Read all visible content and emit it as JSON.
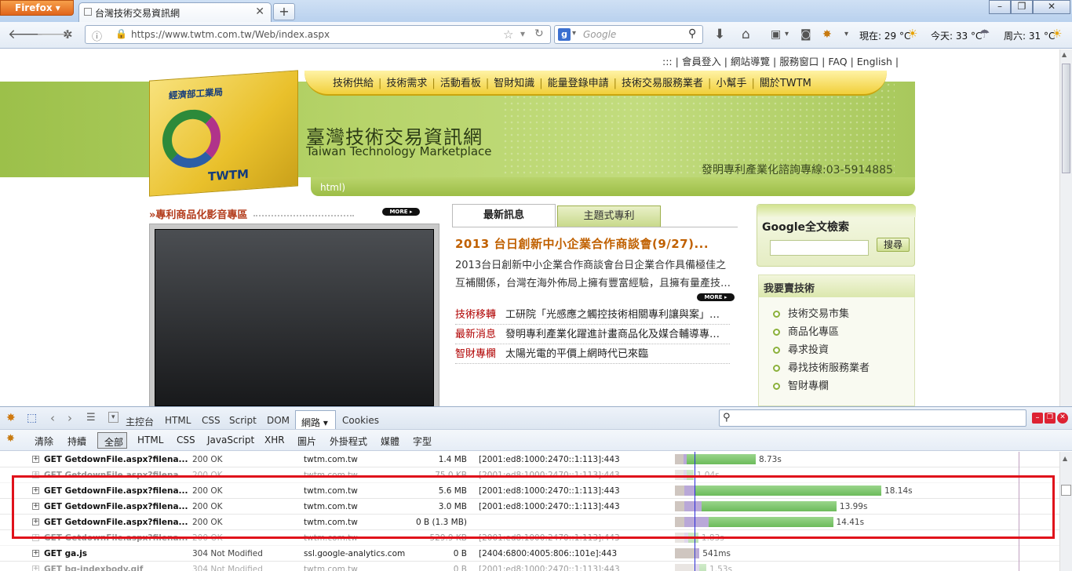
{
  "browser": {
    "app_button": "Firefox",
    "tab_title": "台灣技術交易資訊網",
    "new_tab": "+",
    "url": "https://www.twtm.com.tw/Web/index.aspx",
    "search_engine": "Google",
    "weather_now": "現在: 29 °C",
    "weather_today": "今天: 33 °C",
    "weather_sat": "周六: 31 °C"
  },
  "site": {
    "top_links": [
      ":::",
      "會員登入",
      "網站導覽",
      "服務窗口",
      "FAQ",
      "English"
    ],
    "menu": [
      "技術供給",
      "技術需求",
      "活動看板",
      "智財知識",
      "能量登錄申請",
      "技術交易服務業者",
      "小幫手",
      "關於TWTM"
    ],
    "logo_org": "經濟部工業局",
    "logo_text": "TWTM",
    "title_zh": "臺灣技術交易資訊網",
    "title_en": "Taiwan Technology Marketplace",
    "hotline": "發明專利產業化諮詢專線:03-5914885",
    "greenbar_text": "html)",
    "video_section_title": "專利商品化影音專區",
    "more_label": "MORE",
    "news_tabs": [
      "最新訊息",
      "主題式專利"
    ],
    "news_headline": "2013 台日創新中小企業合作商談會(9/27)...",
    "news_body": "2013台日創新中小企業合作商談會台日企業合作具備極佳之互補關係，台灣在海外佈局上擁有豐富經驗，且擁有量產技…",
    "news_items": [
      {
        "category": "技術移轉",
        "text": "工研院「光感應之觸控技術相關專利讓與案」…"
      },
      {
        "category": "最新消息",
        "text": "發明專利產業化躍進計畫商品化及媒合輔導專…"
      },
      {
        "category": "智財專欄",
        "text": "太陽光電的平價上網時代已來臨"
      }
    ],
    "google_title": "Google全文檢索",
    "google_button": "搜尋",
    "buy_title": "我要賣技術",
    "buy_items": [
      "技術交易市集",
      "商品化專區",
      "尋求投資",
      "尋找技術服務業者",
      "智財專欄"
    ]
  },
  "firebug": {
    "tabs": [
      "主控台",
      "HTML",
      "CSS",
      "Script",
      "DOM",
      "網路",
      "Cookies"
    ],
    "active_tab": "網路",
    "filters": [
      "清除",
      "持續",
      "全部",
      "HTML",
      "CSS",
      "JavaScript",
      "XHR",
      "圖片",
      "外掛程式",
      "媒體",
      "字型"
    ],
    "requests": [
      {
        "req": "GET GetdownFile.aspx?filena...",
        "status": "200 OK",
        "domain": "twtm.com.tw",
        "size": "1.4 MB",
        "ip": "[2001:ed8:1000:2470::1:113]:443",
        "time": "8.73s",
        "pre": 0.024,
        "wait": 0.01,
        "recv": 0.2,
        "dim": false
      },
      {
        "req": "GET GetdownFile.aspx?filena...",
        "status": "200 OK",
        "domain": "twtm.com.tw",
        "size": "75.0 KB",
        "ip": "[2001:ed8:1000:2470::1:113]:443",
        "time": "1.04s",
        "pre": 0.024,
        "wait": 0.01,
        "recv": 0.02,
        "dim": true
      },
      {
        "req": "GET GetdownFile.aspx?filena...",
        "status": "200 OK",
        "domain": "twtm.com.tw",
        "size": "5.6 MB",
        "ip": "[2001:ed8:1000:2470::1:113]:443",
        "time": "18.14s",
        "pre": 0.028,
        "wait": 0.03,
        "recv": 0.54,
        "dim": false
      },
      {
        "req": "GET GetdownFile.aspx?filena...",
        "status": "200 OK",
        "domain": "twtm.com.tw",
        "size": "3.0 MB",
        "ip": "[2001:ed8:1000:2470::1:113]:443",
        "time": "13.99s",
        "pre": 0.028,
        "wait": 0.05,
        "recv": 0.39,
        "dim": false
      },
      {
        "req": "GET GetdownFile.aspx?filena...",
        "status": "200 OK",
        "domain": "twtm.com.tw",
        "size": "0 B (1.3 MB)",
        "ip": "",
        "time": "14.41s",
        "pre": 0.028,
        "wait": 0.07,
        "recv": 0.36,
        "dim": false
      },
      {
        "req": "GET GetdownFile.aspx?filena...",
        "status": "200 OK",
        "domain": "twtm.com.tw",
        "size": "529.9 KB",
        "ip": "[2001:ed8:1000:2470::1:113]:443",
        "time": "1.83s",
        "pre": 0.028,
        "wait": 0.01,
        "recv": 0.03,
        "dim": true
      },
      {
        "req": "GET ga.js",
        "status": "304 Not Modified",
        "domain": "ssl.google-analytics.com",
        "size": "0 B",
        "ip": "[2404:6800:4005:806::101e]:443",
        "time": "541ms",
        "pre": 0.062,
        "wait": 0.005,
        "recv": 0.0,
        "dim": false
      },
      {
        "req": "GET bg-indexbody.gif",
        "status": "304 Not Modified",
        "domain": "twtm.com.tw",
        "size": "0 B",
        "ip": "[2001:ed8:1000:2470::1:113]:443",
        "time": "1.53s",
        "pre": 0.062,
        "wait": 0.005,
        "recv": 0.02,
        "dim": true
      }
    ]
  }
}
